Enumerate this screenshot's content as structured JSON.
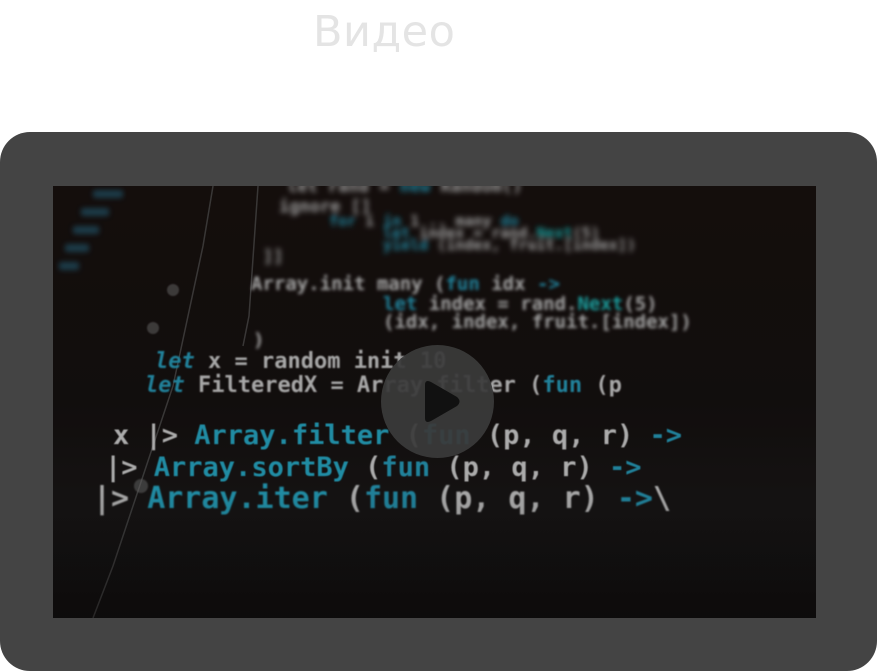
{
  "header": {
    "title": "Видео"
  },
  "video": {
    "play_icon": "play-icon",
    "code_lines": [
      "let rand = new Random()",
      "ignore []",
      "for i in 1 .. many do",
      "let index = rand.Next(5)",
      "yield (index, fruit.[index])",
      "]]",
      "Array.init many (fun idx ->",
      "let index = rand.Next(5)",
      "(idx, index, fruit.[index])",
      ")",
      "let x = random init 10",
      "let FilteredX = Array.filter (fun (p",
      "x |> Array.filter (fun (p, q, r) ->",
      "|> Array.sortBy (fun (p, q, r) ->",
      "|> Array.iter (fun (p, q, r) ->"
    ]
  },
  "colors": {
    "title": "#e4e4e4",
    "card_bg": "#444444",
    "code_text": "#d9d9d9",
    "code_keyword": "#1fa7c7"
  }
}
